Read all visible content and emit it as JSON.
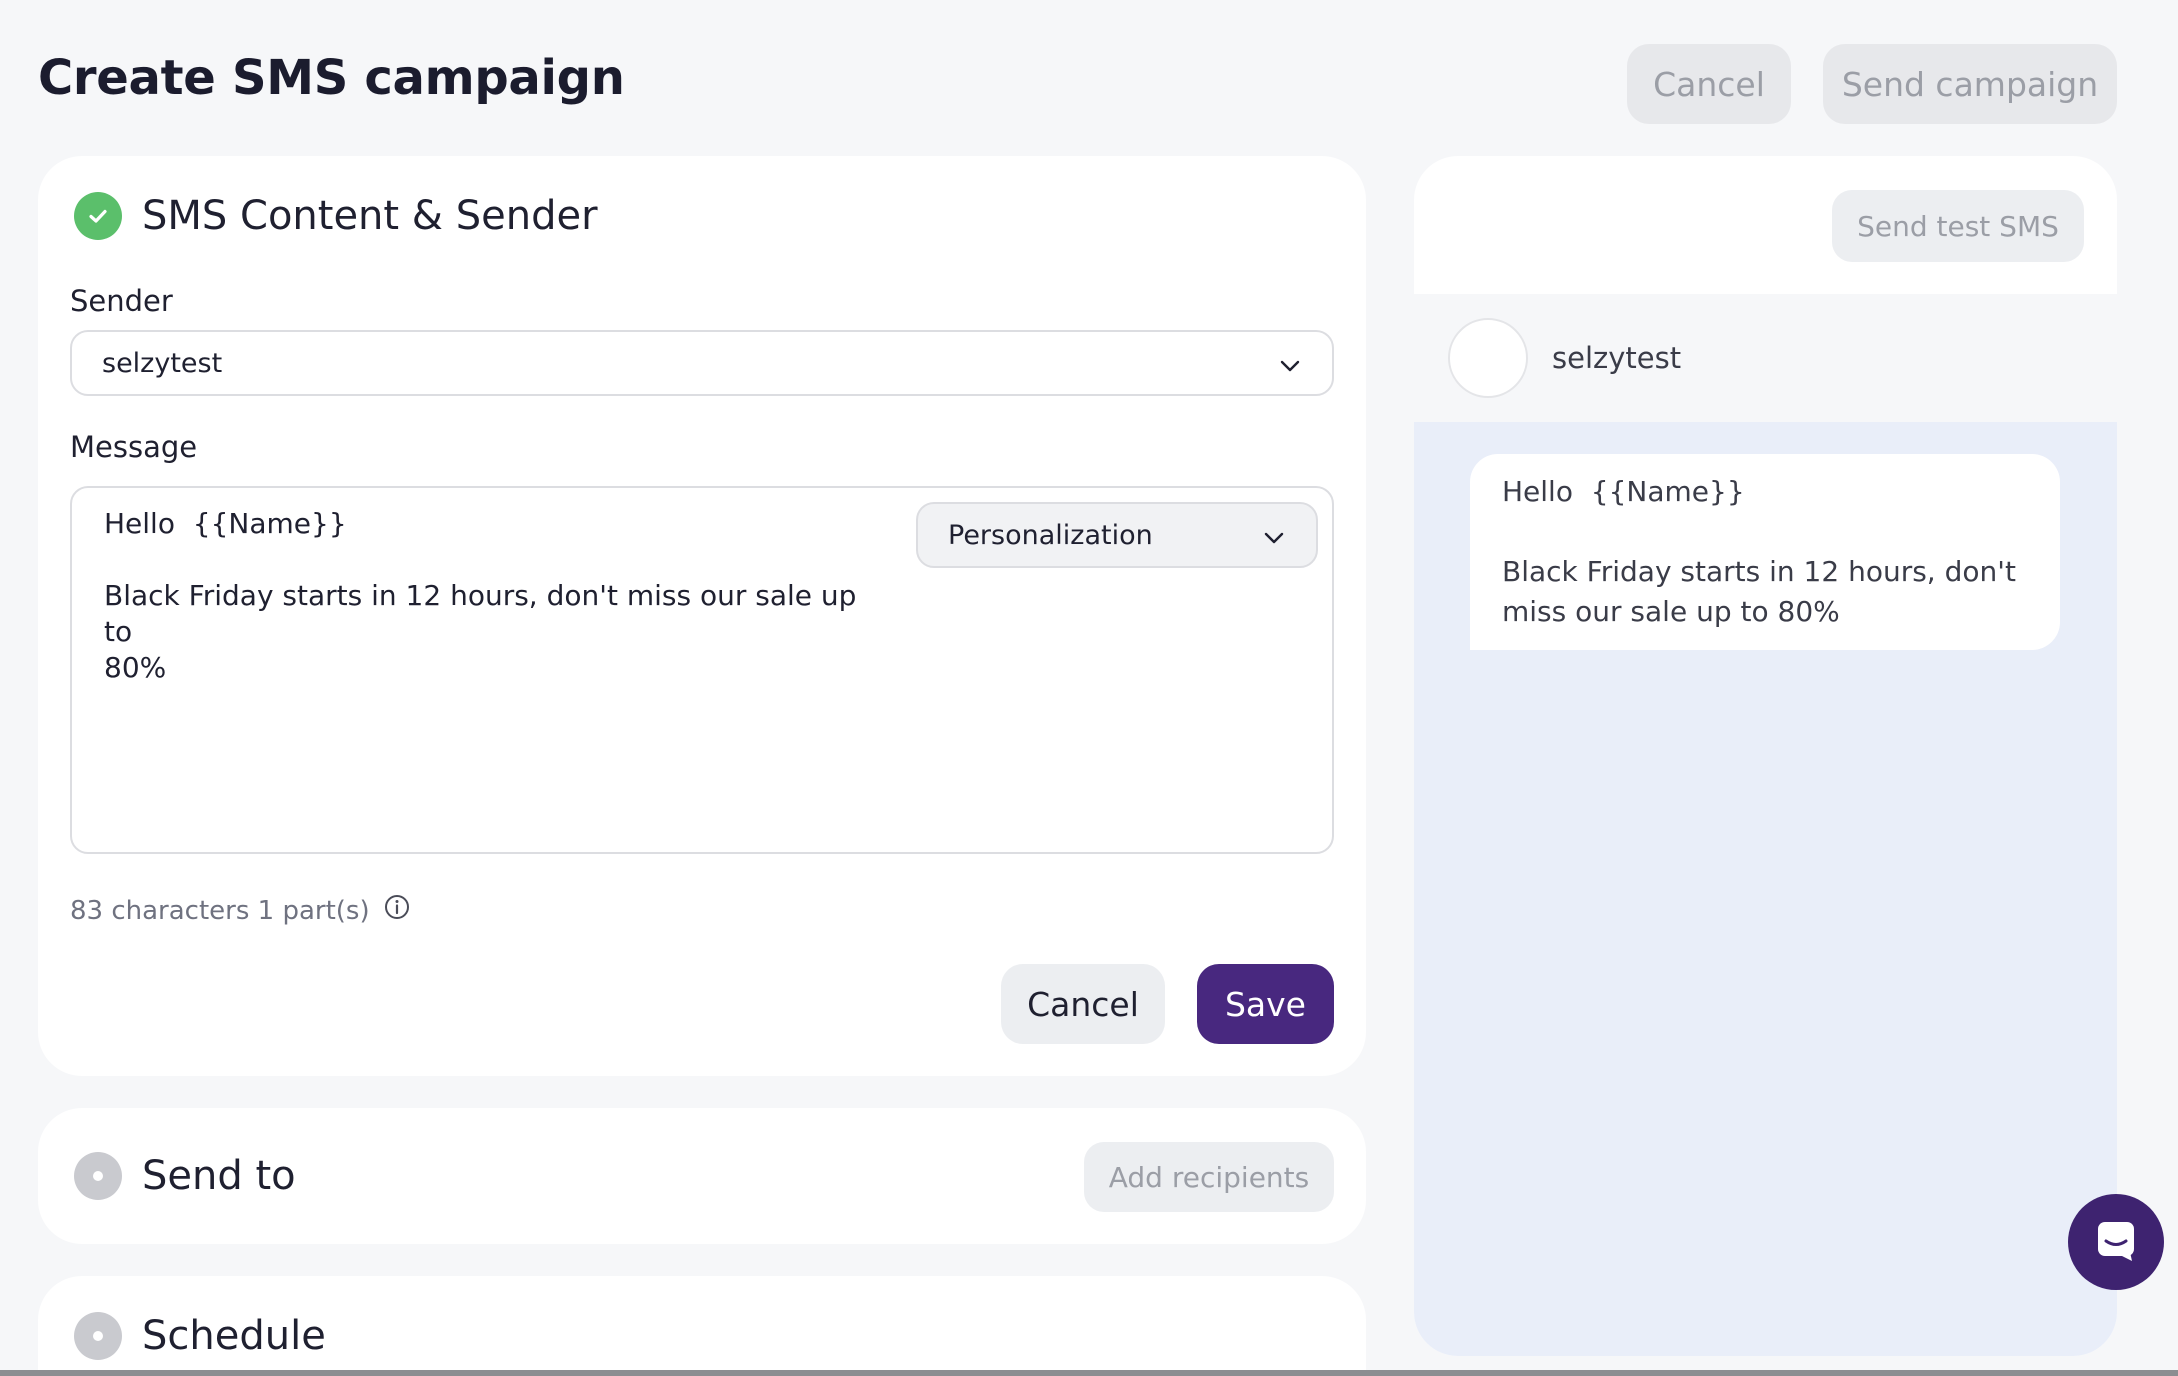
{
  "header": {
    "title": "Create SMS campaign",
    "cancel_label": "Cancel",
    "send_label": "Send campaign"
  },
  "content_section": {
    "title": "SMS Content & Sender",
    "status_icon": "check-circle-icon",
    "sender_label": "Sender",
    "sender_value": "selzytest",
    "message_label": "Message",
    "message_text": "Hello  {{Name}}\n\nBlack Friday starts in 12 hours, don't miss our sale up to\n80%",
    "personalization_label": "Personalization",
    "char_count": "83 characters 1 part(s)",
    "cancel_label": "Cancel",
    "save_label": "Save"
  },
  "send_to_section": {
    "title": "Send to",
    "add_recipients_label": "Add recipients"
  },
  "schedule_section": {
    "title": "Schedule"
  },
  "preview": {
    "send_test_label": "Send test SMS",
    "contact_name": "selzytest",
    "bubble_text": "Hello  {{Name}}\n\nBlack Friday starts in 12 hours, don't\nmiss our sale up to 80%"
  },
  "colors": {
    "accent": "#48287f",
    "success": "#5bbf6b",
    "launcher": "#3e2370"
  }
}
